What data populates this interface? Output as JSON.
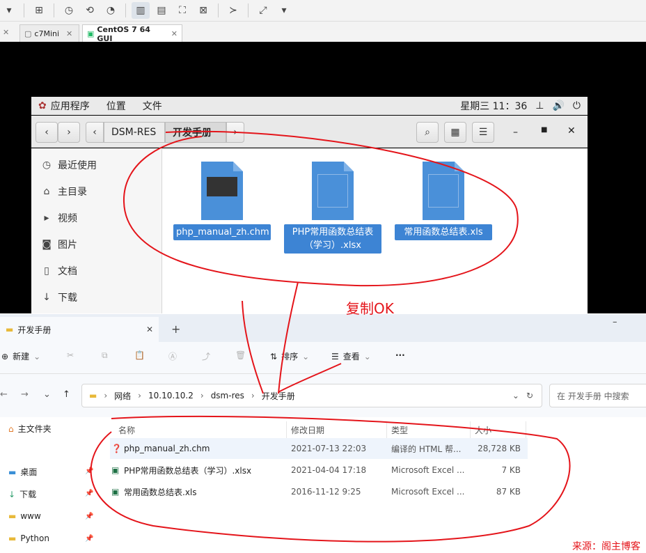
{
  "vm": {
    "tabs": [
      {
        "label": "c7Mini"
      },
      {
        "label": "CentOS 7 64 GUI"
      }
    ]
  },
  "gnome": {
    "menus": [
      "应用程序",
      "位置",
      "文件"
    ],
    "clock": "星期三 11：36"
  },
  "nautilus": {
    "breadcrumbs": [
      "DSM-RES",
      "开发手册"
    ],
    "sidebar": [
      "最近使用",
      "主目录",
      "视频",
      "图片",
      "文档",
      "下载"
    ],
    "files": [
      {
        "name": "php_manual_zh.chm"
      },
      {
        "name": "PHP常用函数总结表（学习）.xlsx",
        "line1": "PHP常用函数总结表",
        "line2": "（学习）.xlsx"
      },
      {
        "name": "常用函数总结表.xls"
      }
    ]
  },
  "annotation": {
    "copy_ok": "复制OK",
    "source": "来源：阁主博客"
  },
  "explorer": {
    "tab_title": "开发手册",
    "commands": {
      "new": "新建",
      "sort": "排序",
      "view": "查看",
      "more": "···"
    },
    "address": [
      "网络",
      "10.10.10.2",
      "dsm-res",
      "开发手册"
    ],
    "search_placeholder": "在 开发手册 中搜索",
    "nav": [
      "主文件夹",
      "桌面",
      "下载",
      "www",
      "Python"
    ],
    "columns": [
      "名称",
      "修改日期",
      "类型",
      "大小"
    ],
    "rows": [
      {
        "name": "php_manual_zh.chm",
        "date": "2021-07-13 22:03",
        "type": "编译的 HTML 帮...",
        "size": "28,728 KB"
      },
      {
        "name": "PHP常用函数总结表（学习）.xlsx",
        "date": "2021-04-04 17:18",
        "type": "Microsoft Excel ...",
        "size": "7 KB"
      },
      {
        "name": "常用函数总结表.xls",
        "date": "2016-11-12 9:25",
        "type": "Microsoft Excel ...",
        "size": "87 KB"
      }
    ]
  },
  "colors": {
    "annotation_red": "#e4141a",
    "selection_blue": "#3d84d4",
    "file_blue": "#4a90d9"
  }
}
